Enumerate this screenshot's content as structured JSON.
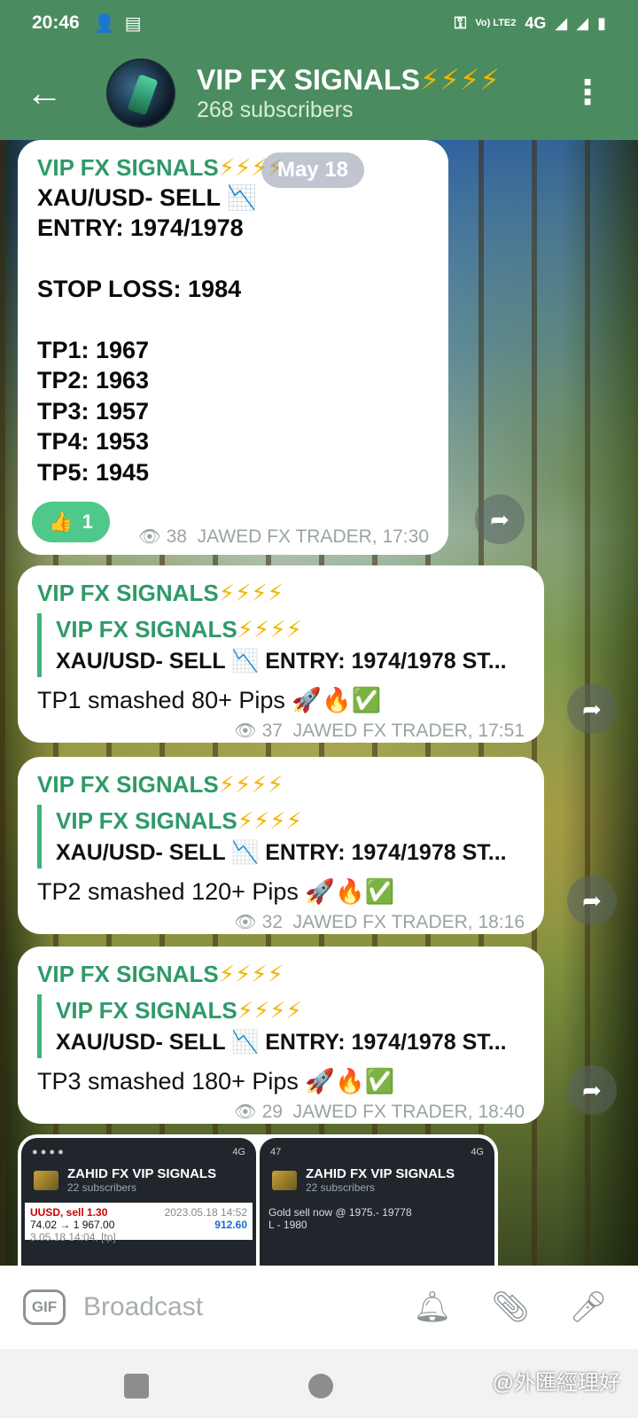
{
  "status": {
    "time": "20:46",
    "network": "4G",
    "volte": "Vo) LTE2"
  },
  "header": {
    "title": "VIP FX SIGNALS",
    "bolts": "⚡⚡⚡⚡",
    "subscribers": "268 subscribers"
  },
  "chat": {
    "date": "May 18",
    "messages": [
      {
        "sender": "VIP FX SIGNALS",
        "lines": [
          "XAU/USD-  SELL 📉",
          "ENTRY: 1974/1978",
          "",
          "STOP LOSS: 1984",
          "",
          "TP1: 1967",
          "TP2: 1963",
          "TP3: 1957",
          "TP4: 1953",
          "TP5: 1945"
        ],
        "reaction_emoji": "👍",
        "reaction_count": "1",
        "views": "38",
        "author_time": "JAWED FX TRADER, 17:30"
      },
      {
        "sender": "VIP FX SIGNALS",
        "reply_sender": "VIP FX SIGNALS",
        "reply_text": "XAU/USD-  SELL 📉   ENTRY: 1974/1978  ST...",
        "body": "TP1 smashed 80+ Pips 🚀🔥✅",
        "views": "37",
        "author_time": "JAWED FX TRADER, 17:51"
      },
      {
        "sender": "VIP FX SIGNALS",
        "reply_sender": "VIP FX SIGNALS",
        "reply_text": "XAU/USD-  SELL 📉   ENTRY: 1974/1978  ST...",
        "body": "TP2 smashed 120+ Pips 🚀🔥✅",
        "views": "32",
        "author_time": "JAWED FX TRADER, 18:16"
      },
      {
        "sender": "VIP FX SIGNALS",
        "reply_sender": "VIP FX SIGNALS",
        "reply_text": "XAU/USD-  SELL 📉   ENTRY: 1974/1978  ST...",
        "body": "TP3 smashed 180+ Pips 🚀🔥✅",
        "views": "29",
        "author_time": "JAWED FX TRADER, 18:40"
      }
    ],
    "thumbs": [
      {
        "title": "ZAHID FX VIP SIGNALS",
        "sub": "22 subscribers",
        "status": "4G",
        "body1": "UUSD, sell 1.30",
        "body2": "74.02 → 1 967.00",
        "date": "2023.05.18 14:52",
        "price": "912.60",
        "body3": "3.05.18 14:04, [tp]"
      },
      {
        "title": "ZAHID FX VIP SIGNALS",
        "sub": "22 subscribers",
        "status": "4G",
        "body1": "Gold sell now @ 1975.- 19778",
        "body2": "L - 1980"
      }
    ]
  },
  "input": {
    "gif_label": "GIF",
    "placeholder": "Broadcast"
  },
  "navbar": {
    "watermark": "@外匯經理好"
  },
  "colors": {
    "header_bg": "#4a8c5f",
    "sender": "#2f9a69",
    "reaction_bg": "#4ec98a",
    "reply_bar": "#3fb37b"
  }
}
